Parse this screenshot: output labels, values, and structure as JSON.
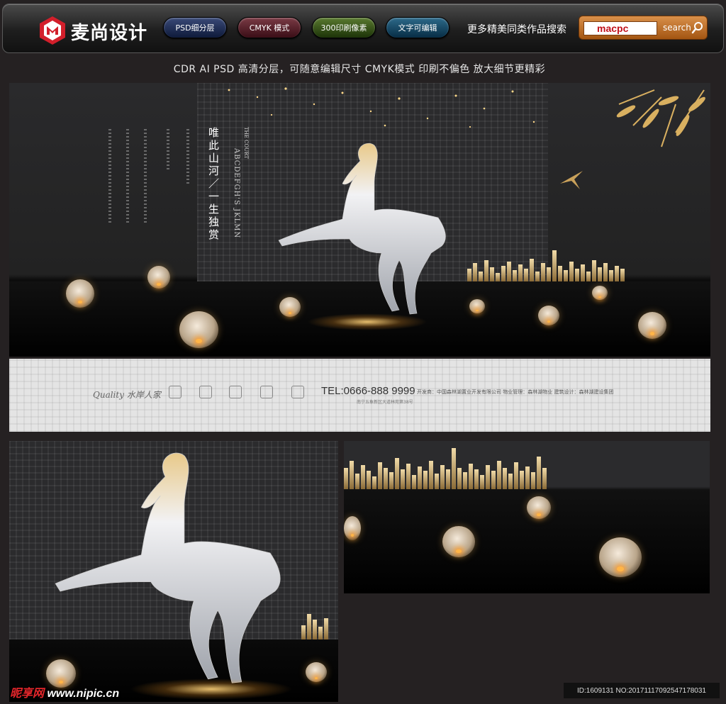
{
  "header": {
    "logo_text": "麦尚设计",
    "pills": [
      "PSD细分层",
      "CMYK 模式",
      "300印刷像素",
      "文字可编辑"
    ],
    "more_text": "更多精美同类作品搜索",
    "search": {
      "value": "macpc",
      "button_label": "search"
    }
  },
  "subtitle": "CDR  AI   PSD 高清分层，可随意编辑尺寸  CMYK模式  印刷不偏色  放大细节更精彩",
  "poster": {
    "slogan": "唯此山河／一生独赏",
    "english_title": "ABCDEFGH'S JKLMN",
    "court_label": "THE COURT"
  },
  "strip": {
    "brand": "Quality 水岸人家",
    "phone": "TEL:0666-888 9999",
    "address": "南宁五象新区大道林苑第38号",
    "credits": "开发商：中国森林湖置业开发有限公司   物业管理：森林湖物业   建筑设计：森林湖建设集团"
  },
  "watermark": {
    "prefix": "昵享网",
    "url": "www.nipic.cn"
  },
  "image_id": "ID:1609131 NO:20171117092547178031",
  "colors": {
    "accent": "#c0111b",
    "gold": "#d8b060",
    "background": "#252122"
  }
}
